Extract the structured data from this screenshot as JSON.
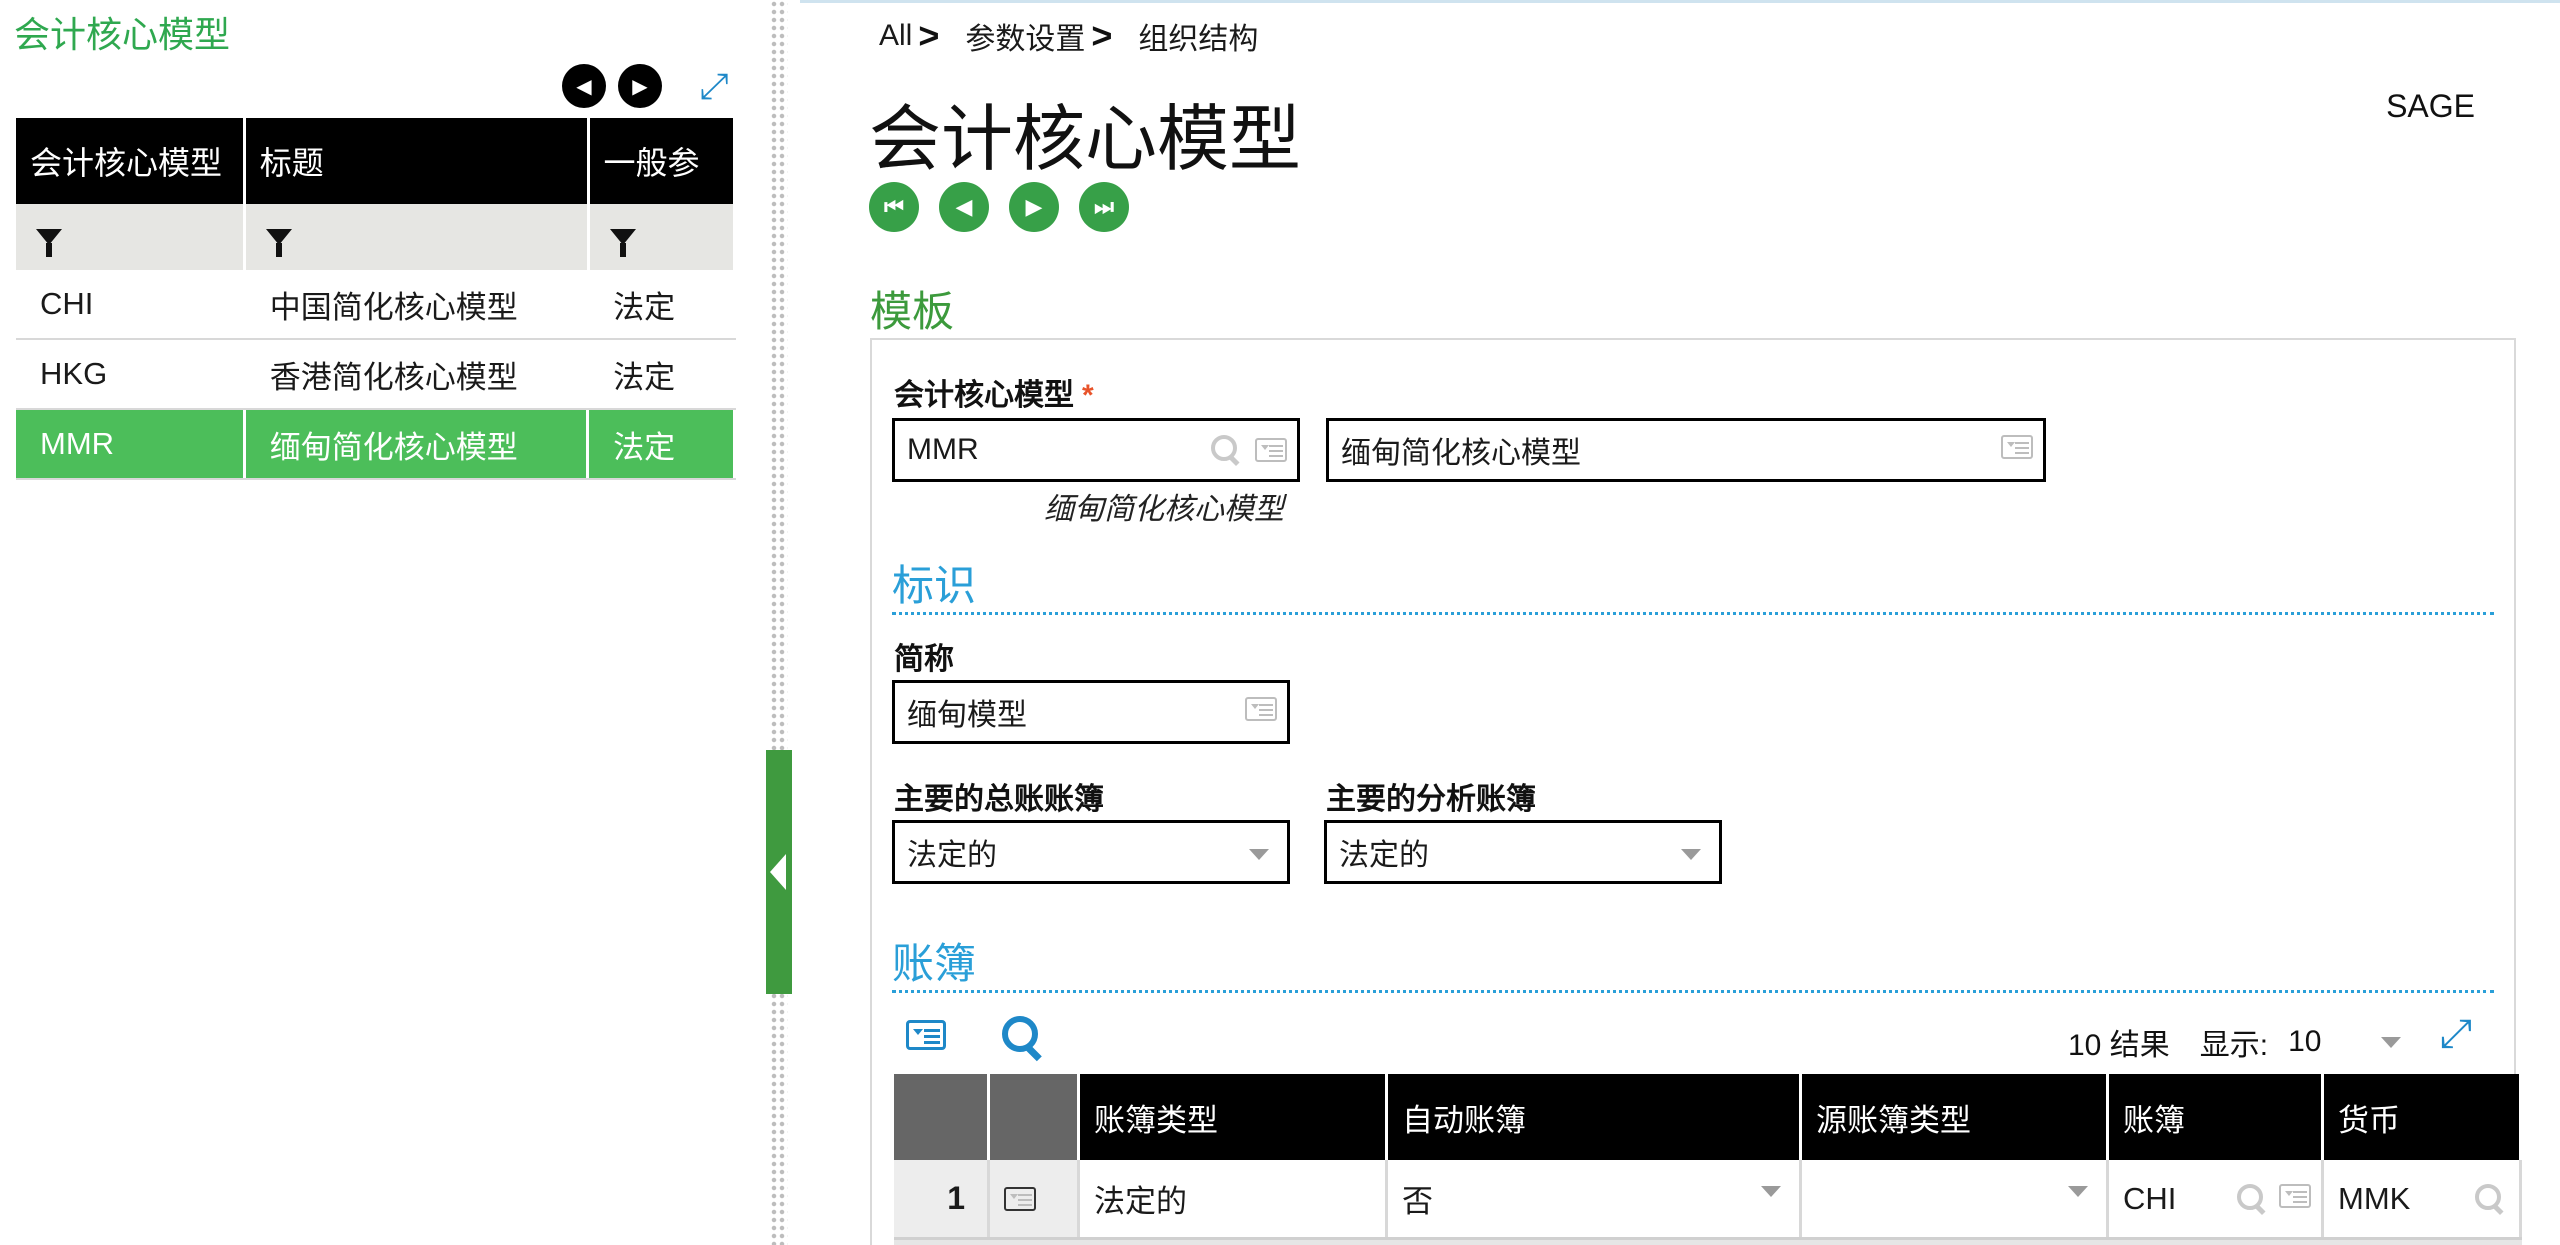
{
  "left": {
    "title": "会计核心模型",
    "columns": [
      "会计核心模型",
      "标题",
      "一般参"
    ],
    "rows": [
      {
        "code": "CHI",
        "title": "中国简化核心模型",
        "general": "法定"
      },
      {
        "code": "HKG",
        "title": "香港简化核心模型",
        "general": "法定"
      },
      {
        "code": "MMR",
        "title": "缅甸简化核心模型",
        "general": "法定",
        "selected": true
      }
    ]
  },
  "breadcrumb": [
    "All",
    "参数设置",
    "组织结构"
  ],
  "page": {
    "title": "会计核心模型",
    "sage": "SAGE"
  },
  "template": {
    "section": "模板",
    "model_label": "会计核心模型",
    "required_mark": "*",
    "model_code": "MMR",
    "model_name": "缅甸简化核心模型",
    "model_caption": "缅甸简化核心模型"
  },
  "identity": {
    "section": "标识",
    "short_label": "简称",
    "short_value": "缅甸模型",
    "gl_label": "主要的总账账簿",
    "gl_value": "法定的",
    "an_label": "主要的分析账簿",
    "an_value": "法定的"
  },
  "ledger": {
    "section": "账簿",
    "results": "10 结果",
    "show_label": "显示:",
    "show_value": "10",
    "columns": [
      "账簿类型",
      "自动账簿",
      "源账簿类型",
      "账簿",
      "货币"
    ],
    "rows": [
      {
        "num": "1",
        "type": "法定的",
        "auto": "否",
        "source": "",
        "ledger": "CHI",
        "currency": "MMK"
      }
    ]
  }
}
